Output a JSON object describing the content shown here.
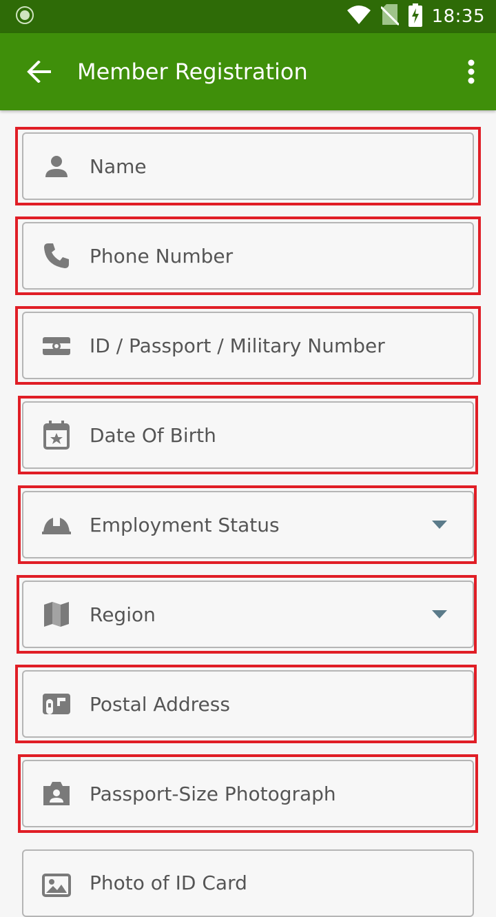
{
  "status_bar": {
    "time": "18:35"
  },
  "app_bar": {
    "title": "Member Registration"
  },
  "fields": [
    {
      "label": "Name",
      "icon": "person-icon",
      "dropdown": false
    },
    {
      "label": "Phone Number",
      "icon": "phone-icon",
      "dropdown": false
    },
    {
      "label": "ID / Passport / Military Number",
      "icon": "id-card-icon",
      "dropdown": false
    },
    {
      "label": "Date Of Birth",
      "icon": "calendar-icon",
      "dropdown": false
    },
    {
      "label": "Employment Status",
      "icon": "hardhat-icon",
      "dropdown": true
    },
    {
      "label": "Region",
      "icon": "map-icon",
      "dropdown": true
    },
    {
      "label": "Postal Address",
      "icon": "mailbox-icon",
      "dropdown": false
    },
    {
      "label": "Passport-Size Photograph",
      "icon": "camera-portrait-icon",
      "dropdown": false
    },
    {
      "label": "Photo of ID Card",
      "icon": "image-icon",
      "dropdown": false
    }
  ],
  "colors": {
    "status_bar": "#2e6b07",
    "app_bar": "#3f8f0a",
    "highlight": "#e01e26",
    "icon": "#7a7a7a",
    "caret": "#5b7b8a"
  }
}
